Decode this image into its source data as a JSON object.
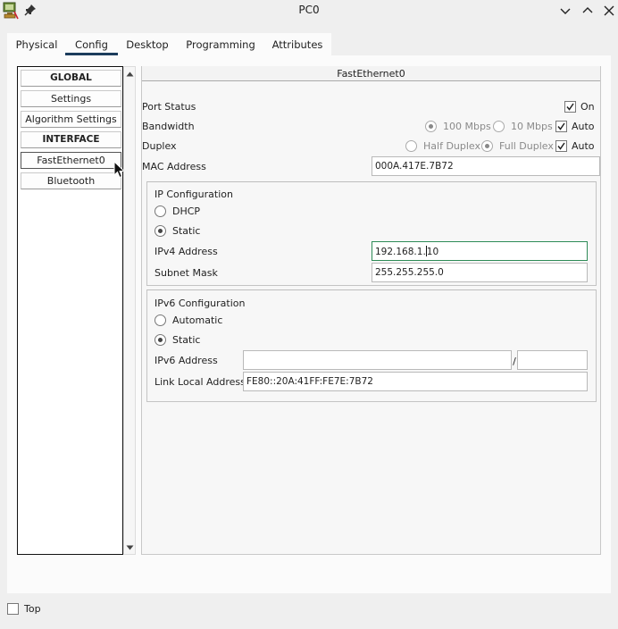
{
  "window": {
    "title": "PC0",
    "app_icon": "packet-tracer-pc-icon",
    "pin_icon": "pin-icon",
    "controls": [
      "chevron-down-icon",
      "chevron-up-icon",
      "close-icon"
    ]
  },
  "tabs": [
    {
      "label": "Physical",
      "active": false
    },
    {
      "label": "Config",
      "active": true
    },
    {
      "label": "Desktop",
      "active": false
    },
    {
      "label": "Programming",
      "active": false
    },
    {
      "label": "Attributes",
      "active": false
    }
  ],
  "sidebar": {
    "items": [
      {
        "label": "GLOBAL",
        "type": "header"
      },
      {
        "label": "Settings",
        "type": "item"
      },
      {
        "label": "Algorithm Settings",
        "type": "item"
      },
      {
        "label": "INTERFACE",
        "type": "header"
      },
      {
        "label": "FastEthernet0",
        "type": "item",
        "selected": true
      },
      {
        "label": "Bluetooth",
        "type": "item"
      }
    ]
  },
  "interface": {
    "title": "FastEthernet0",
    "port_status": {
      "label": "Port Status",
      "on_label": "On",
      "on_checked": true
    },
    "bandwidth": {
      "label": "Bandwidth",
      "opt_100": "100 Mbps",
      "opt_100_checked": true,
      "opt_10": "10 Mbps",
      "opt_10_checked": false,
      "auto_label": "Auto",
      "auto_checked": true
    },
    "duplex": {
      "label": "Duplex",
      "half": "Half Duplex",
      "half_checked": false,
      "full": "Full Duplex",
      "full_checked": true,
      "auto_label": "Auto",
      "auto_checked": true
    },
    "mac": {
      "label": "MAC Address",
      "value": "000A.417E.7B72"
    },
    "ipv4_config": {
      "title": "IP Configuration",
      "dhcp_label": "DHCP",
      "dhcp_checked": false,
      "static_label": "Static",
      "static_checked": true,
      "ipv4_label": "IPv4 Address",
      "ipv4_value_pre": "192.168.1.",
      "ipv4_value_post": "10",
      "mask_label": "Subnet Mask",
      "mask_value": "255.255.255.0"
    },
    "ipv6_config": {
      "title": "IPv6 Configuration",
      "auto_label": "Automatic",
      "auto_checked": false,
      "static_label": "Static",
      "static_checked": true,
      "ipv6_label": "IPv6 Address",
      "ipv6_value": "",
      "prefix_sep": "/",
      "prefix_value": "",
      "link_local_label": "Link Local Address:",
      "link_local_value": "FE80::20A:41FF:FE7E:7B72"
    }
  },
  "footer": {
    "top_label": "Top",
    "top_checked": false
  }
}
